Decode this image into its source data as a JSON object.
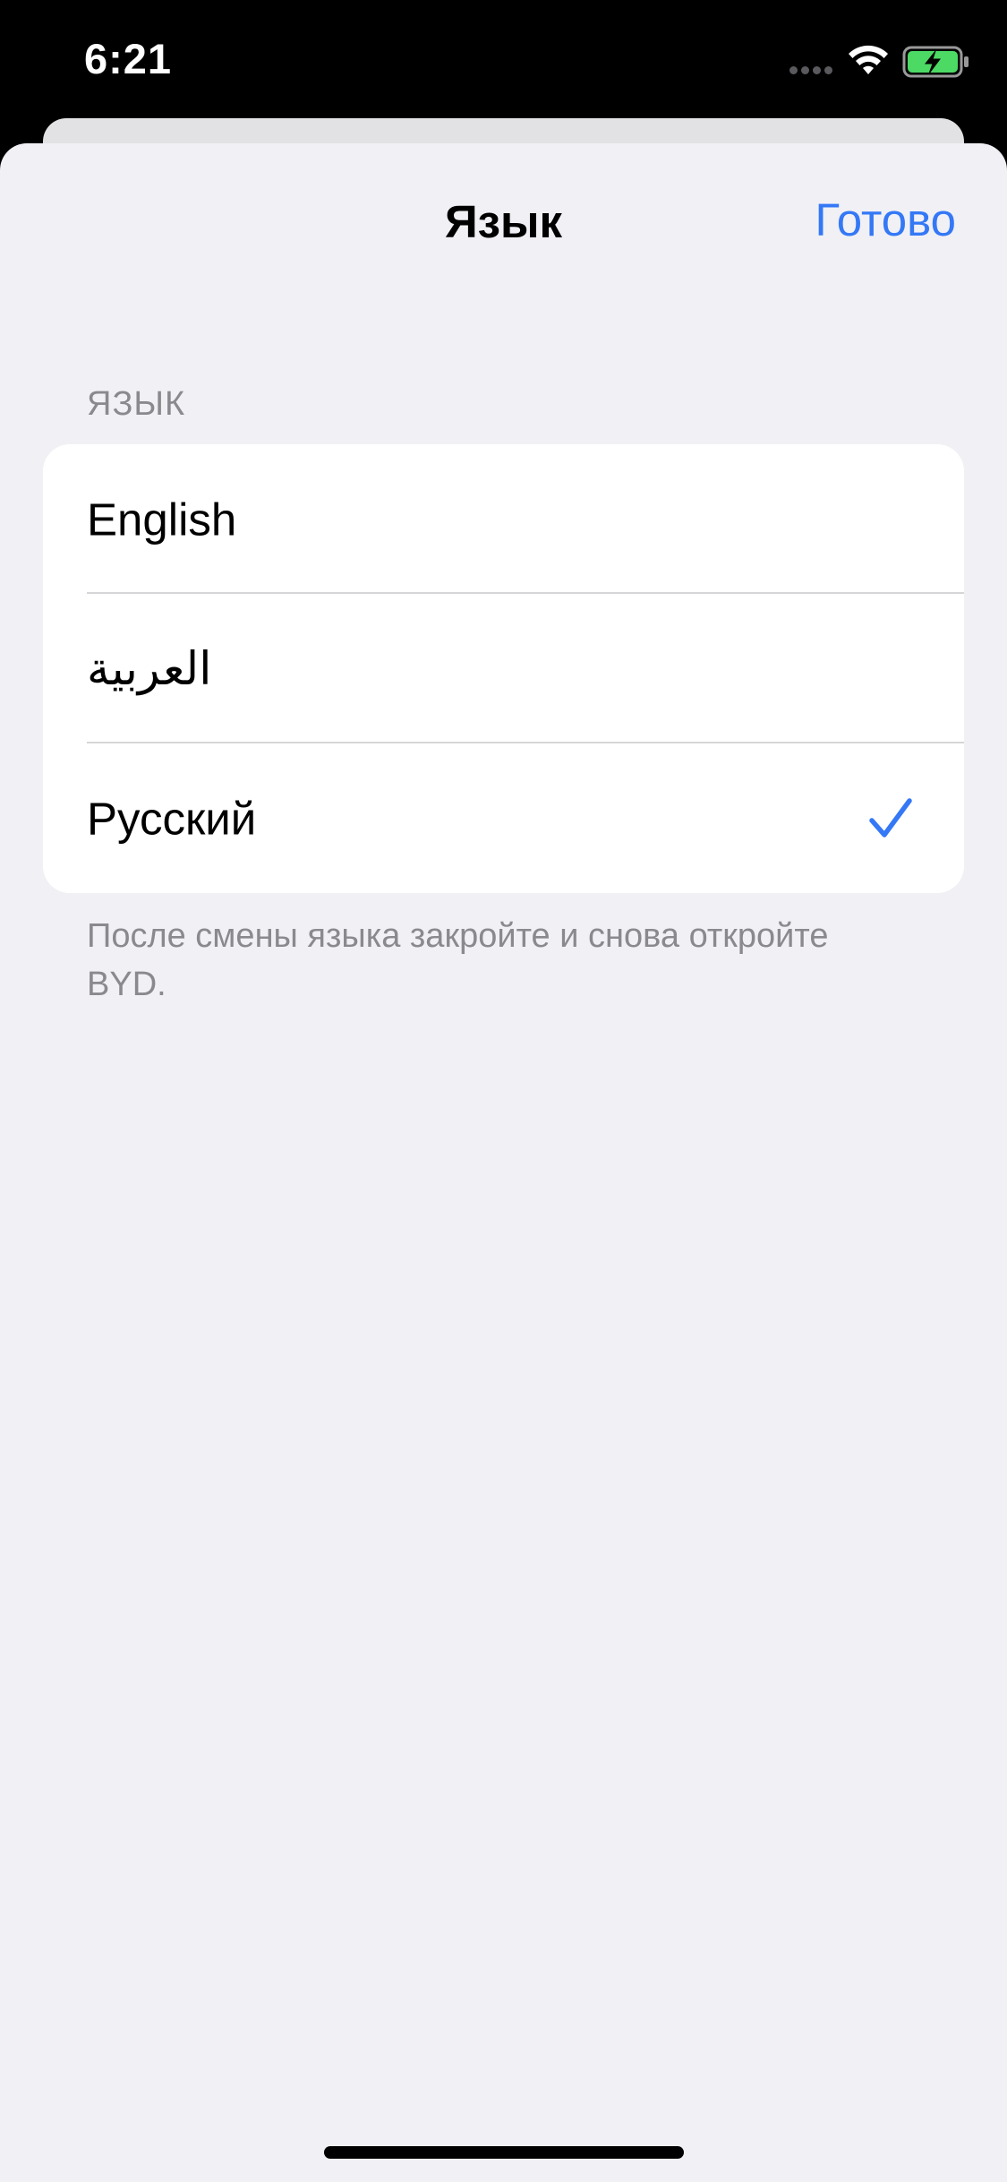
{
  "status_bar": {
    "time": "6:21",
    "wifi_icon": "wifi-icon",
    "battery_icon": "battery-charging-icon",
    "battery_color": "#4cd964"
  },
  "nav": {
    "title": "Язык",
    "done_label": "Готово",
    "accent_color": "#3478f6"
  },
  "section": {
    "header": "ЯЗЫК",
    "options": [
      {
        "label": "English",
        "selected": false
      },
      {
        "label": "العربية",
        "selected": false
      },
      {
        "label": "Русский",
        "selected": true
      }
    ],
    "selected_icon": "checkmark-icon",
    "footer": "После смены языка закройте и снова откройте BYD."
  }
}
